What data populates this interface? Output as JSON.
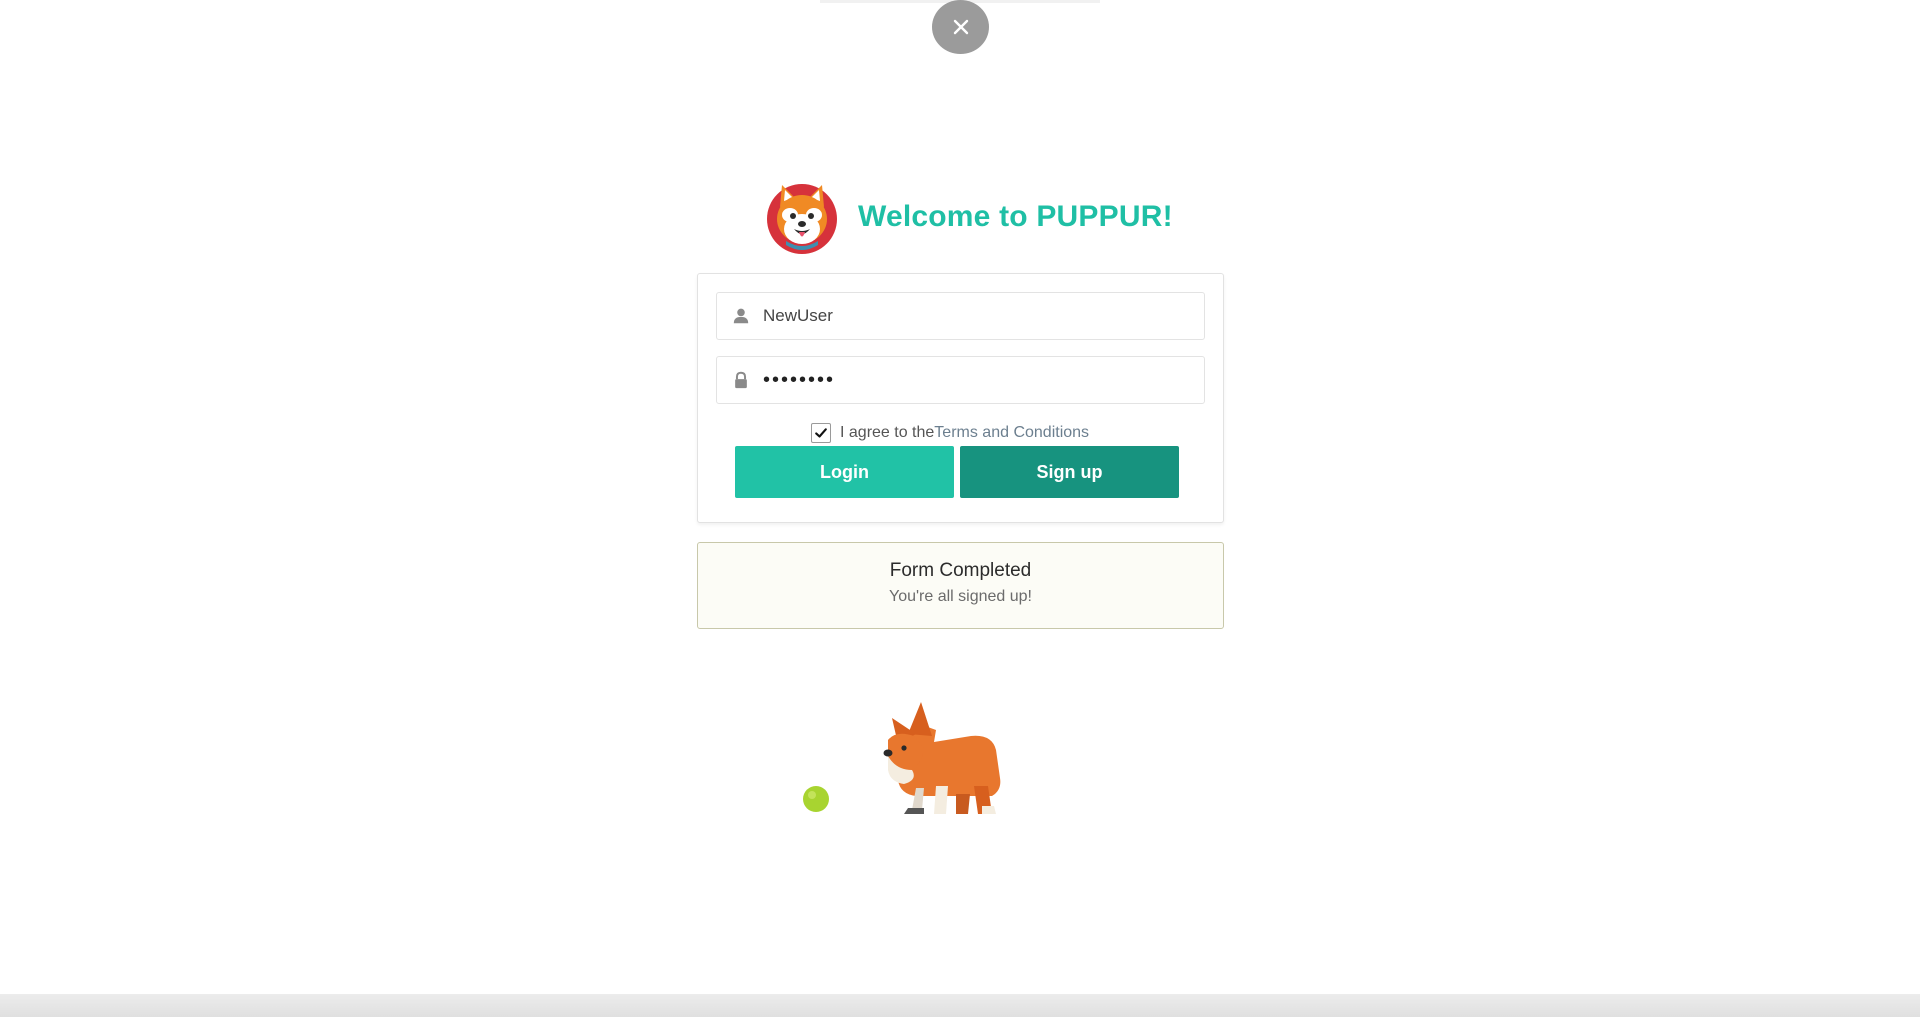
{
  "page": {
    "title": "Welcome to PUPPUR!",
    "close_icon": "close-icon"
  },
  "login_form": {
    "username_icon": "user-icon",
    "username_value": "NewUser",
    "password_icon": "lock-icon",
    "password_value": "••••••••",
    "agree_prefix": "I agree to the",
    "terms_link": "Terms and Conditions",
    "agree_checked": true,
    "login_label": "Login",
    "signup_label": "Sign up"
  },
  "success": {
    "title": "Form Completed",
    "message": "You're all signed up!"
  },
  "colors": {
    "brand_teal": "#1fbfa5",
    "login_button": "#21c2a6",
    "signup_button": "#17937f",
    "close_button": "#9b9b9b"
  },
  "illustration": {
    "icon": "corgi-with-ball-illustration"
  }
}
